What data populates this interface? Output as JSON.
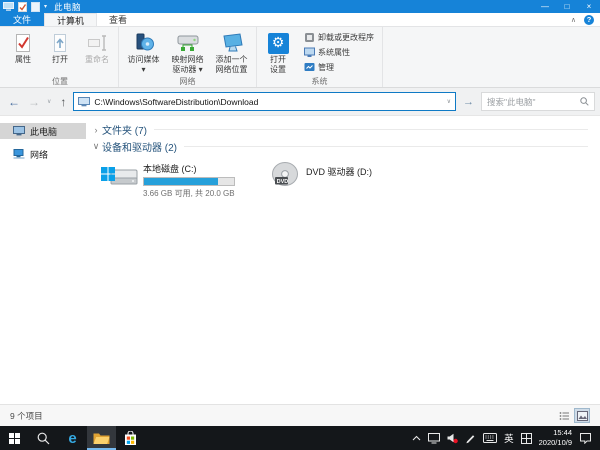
{
  "titlebar": {
    "title": "此电脑",
    "minimize": "—",
    "maximize": "□",
    "close": "×",
    "qat_caret": "▾"
  },
  "tabs": {
    "file": "文件",
    "computer": "计算机",
    "view": "查看",
    "collapse_glyph": "∧",
    "help_glyph": "?"
  },
  "ribbon": {
    "location_group": {
      "label": "位置",
      "properties": "属性",
      "open": "打开",
      "rename": "重命名"
    },
    "network_group": {
      "label": "网络",
      "access_media": "访问媒体\n▾",
      "map_drive": "映射网络\n驱动器 ▾",
      "add_location": "添加一个\n网络位置"
    },
    "system_group": {
      "label": "系统",
      "open_settings": "打开\n设置",
      "gear_glyph": "⚙",
      "uninstall": "卸载或更改程序",
      "system_properties": "系统属性",
      "manage": "管理"
    }
  },
  "navigation": {
    "back_glyph": "←",
    "forward_glyph": "→",
    "history_glyph": "∨",
    "up_glyph": "↑",
    "path": "C:\\Windows\\SoftwareDistribution\\Download",
    "address_dropdown_glyph": "∨",
    "go_glyph": "→",
    "search_placeholder": "搜索\"此电脑\""
  },
  "sidebar": {
    "this_pc": "此电脑",
    "network": "网络"
  },
  "content": {
    "folders_group": "文件夹 (7)",
    "folders_chevron": "›",
    "devices_group": "设备和驱动器 (2)",
    "devices_chevron": "∨",
    "drive_c": {
      "name": "本地磁盘 (C:)",
      "detail": "3.66 GB 可用, 共 20.0 GB",
      "usage_percent": 82
    },
    "drive_d": {
      "name": "DVD 驱动器 (D:)",
      "disc_label": "DVD"
    }
  },
  "statusbar": {
    "items_count": "9 个项目"
  },
  "taskbar": {
    "edge_glyph": "e",
    "ime_indicator": "英",
    "time": "15:44",
    "date": "2020/10/9"
  },
  "colors": {
    "accent": "#1683d8",
    "drive_usage": "#26a0da",
    "mute_badge": "#e81123",
    "taskbar": "#14171a",
    "store_red": "#f25022",
    "store_green": "#7fba00",
    "store_blue": "#00a4ef",
    "store_yellow": "#ffb900"
  }
}
